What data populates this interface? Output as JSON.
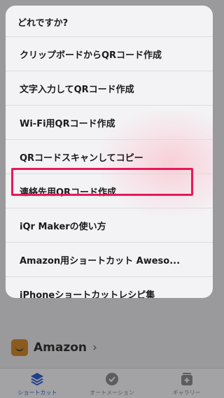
{
  "menu": {
    "title": "どれですか?",
    "items": [
      {
        "label": "クリップボードからQRコード作成"
      },
      {
        "label": "文字入力してQRコード作成"
      },
      {
        "label": "Wi-Fi用QRコード作成"
      },
      {
        "label": "QRコードスキャンしてコピー"
      },
      {
        "label": "連絡先用QRコード作成",
        "highlighted": true
      },
      {
        "label": "iQr Makerの使い方"
      },
      {
        "label": "Amazon用ショートカット Aweso..."
      },
      {
        "label": "iPhoneショートカットレシピ集"
      }
    ]
  },
  "background": {
    "row_label": "Amazon",
    "row_chevron": "›"
  },
  "tabbar": {
    "tabs": [
      {
        "label": "ショートカット",
        "icon": "layers-icon",
        "active": true
      },
      {
        "label": "オートメーション",
        "icon": "clock-check-icon",
        "active": false
      },
      {
        "label": "ギャラリー",
        "icon": "gallery-plus-icon",
        "active": false
      }
    ]
  },
  "colors": {
    "highlight": "#e8185a",
    "active_tab": "#1f3f8a"
  }
}
